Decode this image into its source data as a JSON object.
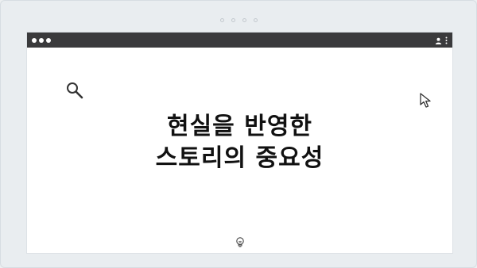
{
  "heading": {
    "line1": "현실을 반영한",
    "line2": "스토리의 중요성"
  },
  "icons": {
    "search": "search-icon",
    "cursor": "cursor-arrow-icon",
    "idea": "lightbulb-icon",
    "user": "user-icon",
    "menu": "more-vertical-icon"
  },
  "colors": {
    "titlebar": "#3a3a3c",
    "background": "#e9edf0",
    "window": "#ffffff",
    "text": "#111111"
  }
}
